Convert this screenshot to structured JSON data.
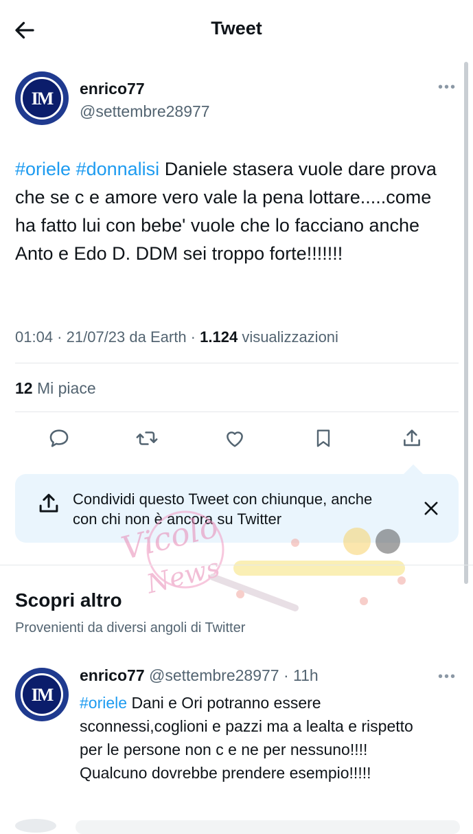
{
  "header": {
    "title": "Tweet"
  },
  "tweet": {
    "display_name": "enrico77",
    "handle": "@settembre28977",
    "hashtags": [
      "#oriele",
      "#donnalisi"
    ],
    "text": "Daniele stasera vuole dare prova che se c e amore vero vale la pena lottare.....come ha fatto lui con bebe' vuole che lo facciano anche Anto e Edo D.  DDM sei troppo forte!!!!!!!",
    "time": "01:04",
    "date": "21/07/23",
    "source": "da Earth",
    "views_count": "1.124",
    "views_label": "visualizzazioni",
    "likes_count": "12",
    "likes_label": "Mi piace"
  },
  "share_prompt": {
    "text": "Condividi questo Tweet con chiunque, anche con chi non è ancora su Twitter"
  },
  "discover": {
    "title": "Scopri altro",
    "subtitle": "Provenienti da diversi angoli di Twitter"
  },
  "reply": {
    "display_name": "enrico77",
    "handle": "@settembre28977",
    "time": "11h",
    "hashtag": "#oriele",
    "text": "Dani e Ori potranno essere sconnessi,coglioni e pazzi ma a lealta e rispetto per le persone non c e ne per nessuno!!!! Qualcuno dovrebbe prendere esempio!!!!!"
  },
  "watermark": {
    "brand": "Vicolo delle News"
  },
  "colors": {
    "accent": "#1d9bf0",
    "share_bg": "#eaf5fd",
    "secondary_text": "#536471"
  }
}
